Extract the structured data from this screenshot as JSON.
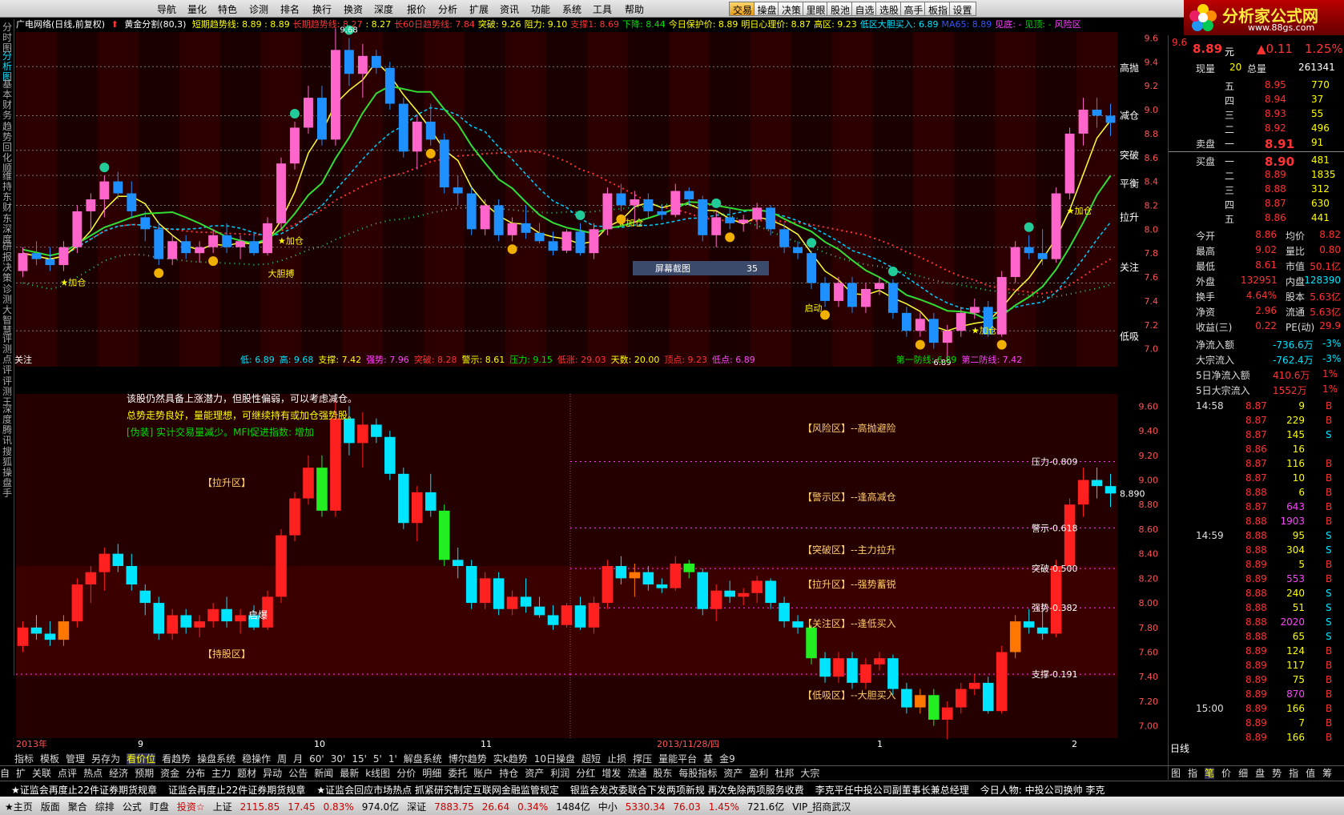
{
  "menu": {
    "items": [
      "导航",
      "量化",
      "特色",
      "诊测",
      "排名",
      "换行",
      "换资",
      "深度",
      "报价",
      "分析",
      "扩展",
      "资讯",
      "功能",
      "系统",
      "工具",
      "帮助"
    ],
    "toolbar": [
      "交易",
      "操盘",
      "决策",
      "里眼",
      "股池",
      "自选",
      "选股",
      "高手",
      "板指",
      "设置"
    ]
  },
  "logo": {
    "title": "分析家公式网",
    "url": "www.88gs.com"
  },
  "sidebar": [
    "分时图",
    "分析图",
    "基本",
    "财务",
    "趋势",
    "回化顺",
    "维持",
    "东财",
    "东深度",
    "研报",
    "决策",
    "诊测",
    "大智慧",
    "评测",
    "点评",
    "评测王",
    "深度",
    "腾讯",
    "搜狐",
    "操盘手"
  ],
  "header": {
    "name": "广电网络(日线,前复权)",
    "indicator": "黄金分割(80,3)",
    "items": [
      {
        "t": "短期趋势线: 8.89 : 8.89",
        "c": "#ffff00"
      },
      {
        "t": "长期趋势线: 8.27",
        "c": "#ff3333"
      },
      {
        "t": ": 8.27",
        "c": "#ffff00"
      },
      {
        "t": "长60日趋势线: 7.84",
        "c": "#ff3333"
      },
      {
        "t": "突破: 9.26",
        "c": "#ffff00"
      },
      {
        "t": "阻力: 9.10",
        "c": "#ffff00"
      },
      {
        "t": "支撑1: 8.69",
        "c": "#ff3333"
      },
      {
        "t": "下降: 8.44",
        "c": "#00e000"
      },
      {
        "t": "今日保护价: 8.89",
        "c": "#ffff00"
      },
      {
        "t": "明日心理价: 8.87",
        "c": "#ffff00"
      },
      {
        "t": "高区: 9.23",
        "c": "#ffff00"
      },
      {
        "t": "低区大胆买入: 6.89",
        "c": "#00e5ff"
      },
      {
        "t": "MA65: 8.89",
        "c": "#3355ff"
      },
      {
        "t": "见底: -",
        "c": "#ff44ff"
      },
      {
        "t": "见顶: -",
        "c": "#00e000"
      },
      {
        "t": "风险区",
        "c": "#ff44ff"
      }
    ]
  },
  "main_chart": {
    "y_ticks": [
      "9.6",
      "9.4",
      "9.2",
      "9.0",
      "8.8",
      "8.6",
      "8.4",
      "8.2",
      "8.0",
      "7.8",
      "7.6",
      "7.4",
      "7.2",
      "7.0"
    ],
    "right_labels": [
      "高抛",
      "减仓",
      "突破",
      "平衡",
      "拉升",
      "关注",
      "低吸"
    ],
    "annotations": [
      "加仓",
      "加仓",
      "加仓",
      "加仓",
      "大胆搏",
      "启动",
      "屏幕截图",
      "35",
      "9.68",
      "6.89"
    ],
    "candles": [
      {
        "o": 7.65,
        "h": 7.85,
        "l": 7.6,
        "c": 7.8
      },
      {
        "o": 7.8,
        "h": 7.9,
        "l": 7.7,
        "c": 7.75
      },
      {
        "o": 7.75,
        "h": 7.85,
        "l": 7.65,
        "c": 7.7
      },
      {
        "o": 7.7,
        "h": 7.9,
        "l": 7.65,
        "c": 7.85
      },
      {
        "o": 7.85,
        "h": 8.2,
        "l": 7.8,
        "c": 8.15
      },
      {
        "o": 8.15,
        "h": 8.3,
        "l": 8.0,
        "c": 8.25
      },
      {
        "o": 8.25,
        "h": 8.45,
        "l": 8.1,
        "c": 8.4
      },
      {
        "o": 8.4,
        "h": 8.48,
        "l": 8.25,
        "c": 8.3
      },
      {
        "o": 8.3,
        "h": 8.4,
        "l": 8.1,
        "c": 8.15
      },
      {
        "o": 8.1,
        "h": 8.15,
        "l": 7.9,
        "c": 8.0
      },
      {
        "o": 8.0,
        "h": 8.05,
        "l": 7.7,
        "c": 7.75
      },
      {
        "o": 7.75,
        "h": 7.95,
        "l": 7.7,
        "c": 7.9
      },
      {
        "o": 7.9,
        "h": 7.95,
        "l": 7.75,
        "c": 7.8
      },
      {
        "o": 7.8,
        "h": 7.9,
        "l": 7.72,
        "c": 7.85
      },
      {
        "o": 7.85,
        "h": 8.0,
        "l": 7.8,
        "c": 7.95
      },
      {
        "o": 7.95,
        "h": 8.05,
        "l": 7.8,
        "c": 7.85
      },
      {
        "o": 7.85,
        "h": 7.95,
        "l": 7.75,
        "c": 7.9
      },
      {
        "o": 7.9,
        "h": 7.98,
        "l": 7.78,
        "c": 7.8
      },
      {
        "o": 7.8,
        "h": 8.1,
        "l": 7.78,
        "c": 8.05
      },
      {
        "o": 8.05,
        "h": 8.6,
        "l": 8.0,
        "c": 8.55
      },
      {
        "o": 8.55,
        "h": 8.9,
        "l": 8.5,
        "c": 8.85
      },
      {
        "o": 8.85,
        "h": 9.2,
        "l": 8.8,
        "c": 9.1
      },
      {
        "o": 9.1,
        "h": 9.2,
        "l": 8.7,
        "c": 8.75
      },
      {
        "o": 8.75,
        "h": 9.68,
        "l": 8.7,
        "c": 9.5
      },
      {
        "o": 9.5,
        "h": 9.6,
        "l": 9.2,
        "c": 9.3
      },
      {
        "o": 9.3,
        "h": 9.55,
        "l": 9.1,
        "c": 9.45
      },
      {
        "o": 9.45,
        "h": 9.5,
        "l": 9.3,
        "c": 9.35
      },
      {
        "o": 9.35,
        "h": 9.4,
        "l": 9.0,
        "c": 9.05
      },
      {
        "o": 9.05,
        "h": 9.1,
        "l": 8.6,
        "c": 8.65
      },
      {
        "o": 8.65,
        "h": 8.95,
        "l": 8.5,
        "c": 8.9
      },
      {
        "o": 8.9,
        "h": 9.05,
        "l": 8.7,
        "c": 8.75
      },
      {
        "o": 8.75,
        "h": 8.8,
        "l": 8.3,
        "c": 8.35
      },
      {
        "o": 8.35,
        "h": 8.45,
        "l": 8.2,
        "c": 8.3
      },
      {
        "o": 8.3,
        "h": 8.35,
        "l": 7.95,
        "c": 8.0
      },
      {
        "o": 8.0,
        "h": 8.25,
        "l": 7.95,
        "c": 8.2
      },
      {
        "o": 8.2,
        "h": 8.25,
        "l": 7.9,
        "c": 7.95
      },
      {
        "o": 7.95,
        "h": 8.1,
        "l": 7.9,
        "c": 8.05
      },
      {
        "o": 8.05,
        "h": 8.2,
        "l": 7.92,
        "c": 7.97
      },
      {
        "o": 7.97,
        "h": 8.05,
        "l": 7.88,
        "c": 7.9
      },
      {
        "o": 7.9,
        "h": 7.98,
        "l": 7.78,
        "c": 7.82
      },
      {
        "o": 7.82,
        "h": 8.0,
        "l": 7.8,
        "c": 7.98
      },
      {
        "o": 7.98,
        "h": 8.05,
        "l": 7.78,
        "c": 7.8
      },
      {
        "o": 7.8,
        "h": 8.05,
        "l": 7.75,
        "c": 8.0
      },
      {
        "o": 8.0,
        "h": 8.35,
        "l": 7.95,
        "c": 8.3
      },
      {
        "o": 8.3,
        "h": 8.38,
        "l": 8.15,
        "c": 8.2
      },
      {
        "o": 8.2,
        "h": 8.32,
        "l": 8.05,
        "c": 8.25
      },
      {
        "o": 8.25,
        "h": 8.3,
        "l": 8.1,
        "c": 8.15
      },
      {
        "o": 8.15,
        "h": 8.2,
        "l": 8.08,
        "c": 8.12
      },
      {
        "o": 8.12,
        "h": 8.38,
        "l": 8.1,
        "c": 8.32
      },
      {
        "o": 8.32,
        "h": 8.35,
        "l": 8.2,
        "c": 8.25
      },
      {
        "o": 8.25,
        "h": 8.28,
        "l": 7.9,
        "c": 7.95
      },
      {
        "o": 7.95,
        "h": 8.15,
        "l": 7.85,
        "c": 8.1
      },
      {
        "o": 8.1,
        "h": 8.18,
        "l": 8.0,
        "c": 8.05
      },
      {
        "o": 8.05,
        "h": 8.12,
        "l": 7.98,
        "c": 8.08
      },
      {
        "o": 8.08,
        "h": 8.22,
        "l": 8.0,
        "c": 8.18
      },
      {
        "o": 8.18,
        "h": 8.2,
        "l": 7.95,
        "c": 8.0
      },
      {
        "o": 8.0,
        "h": 8.05,
        "l": 7.8,
        "c": 7.85
      },
      {
        "o": 7.85,
        "h": 7.9,
        "l": 7.75,
        "c": 7.8
      },
      {
        "o": 7.8,
        "h": 7.82,
        "l": 7.5,
        "c": 7.55
      },
      {
        "o": 7.55,
        "h": 7.6,
        "l": 7.35,
        "c": 7.4
      },
      {
        "o": 7.4,
        "h": 7.6,
        "l": 7.35,
        "c": 7.55
      },
      {
        "o": 7.55,
        "h": 7.6,
        "l": 7.3,
        "c": 7.35
      },
      {
        "o": 7.35,
        "h": 7.55,
        "l": 7.3,
        "c": 7.5
      },
      {
        "o": 7.5,
        "h": 7.6,
        "l": 7.45,
        "c": 7.55
      },
      {
        "o": 7.55,
        "h": 7.58,
        "l": 7.25,
        "c": 7.3
      },
      {
        "o": 7.3,
        "h": 7.35,
        "l": 7.1,
        "c": 7.15
      },
      {
        "o": 7.15,
        "h": 7.3,
        "l": 7.1,
        "c": 7.25
      },
      {
        "o": 7.25,
        "h": 7.3,
        "l": 7.0,
        "c": 7.05
      },
      {
        "o": 7.05,
        "h": 7.2,
        "l": 6.89,
        "c": 7.15
      },
      {
        "o": 7.15,
        "h": 7.35,
        "l": 7.1,
        "c": 7.3
      },
      {
        "o": 7.3,
        "h": 7.42,
        "l": 7.25,
        "c": 7.35
      },
      {
        "o": 7.35,
        "h": 7.4,
        "l": 7.1,
        "c": 7.12
      },
      {
        "o": 7.12,
        "h": 7.65,
        "l": 7.1,
        "c": 7.6
      },
      {
        "o": 7.6,
        "h": 7.9,
        "l": 7.55,
        "c": 7.85
      },
      {
        "o": 7.85,
        "h": 7.95,
        "l": 7.75,
        "c": 7.8
      },
      {
        "o": 7.8,
        "h": 8.0,
        "l": 7.7,
        "c": 7.75
      },
      {
        "o": 7.75,
        "h": 8.35,
        "l": 7.72,
        "c": 8.3
      },
      {
        "o": 8.3,
        "h": 8.85,
        "l": 8.25,
        "c": 8.8
      },
      {
        "o": 8.8,
        "h": 9.1,
        "l": 8.7,
        "c": 9.0
      },
      {
        "o": 9.0,
        "h": 9.1,
        "l": 8.85,
        "c": 8.95
      },
      {
        "o": 8.95,
        "h": 9.05,
        "l": 8.78,
        "c": 8.89
      }
    ]
  },
  "main_stats": {
    "left": "关注",
    "items": [
      {
        "t": "低: 6.89",
        "c": "#00e5ff"
      },
      {
        "t": "高: 9.68",
        "c": "#00e5ff"
      },
      {
        "t": "支撑: 7.42",
        "c": "#ffff00"
      },
      {
        "t": "强势: 7.96",
        "c": "#ff44ff"
      },
      {
        "t": "突破: 8.28",
        "c": "#ff3333"
      },
      {
        "t": "警示: 8.61",
        "c": "#ffff00"
      },
      {
        "t": "压力: 9.15",
        "c": "#00e000"
      },
      {
        "t": "低涨: 29.03",
        "c": "#ff3333"
      },
      {
        "t": "天数: 20.00",
        "c": "#ffff00"
      },
      {
        "t": "顶点: 9.23",
        "c": "#ff3333"
      },
      {
        "t": "低点: 6.89",
        "c": "#ff44ff"
      }
    ],
    "right": [
      {
        "t": "第一防线: 6.89",
        "c": "#00e000"
      },
      {
        "t": "第二防线: 7.42",
        "c": "#ff44ff"
      }
    ]
  },
  "lower_chart": {
    "texts": [
      {
        "t": "该股仍然具备上涨潜力，但股性偏弱，可以考虑减仓。",
        "c": "#fff"
      },
      {
        "t": "总势走势良好，量能理想，可继续持有或加仓强势股。",
        "c": "#ffff00"
      },
      {
        "t": "[伪装] 实计交易量减少。MFI促进指数: 增加",
        "c": "#00e000"
      }
    ],
    "zones_left": [
      "【拉升区】",
      "【持股区】"
    ],
    "zones_right": [
      "【风险区】--高抛避险",
      "【警示区】--逢高减仓",
      "【突破区】--主力拉升",
      "【拉升区】--强势蓄锐",
      "【关注区】--逢低买入",
      "【低吸区】--大胆买入"
    ],
    "levels": [
      "压力-0.809",
      "警示-0.618",
      "突破-0.500",
      "强势-0.382",
      "支撑-0.191"
    ],
    "y_ticks": [
      "9.60",
      "9.40",
      "9.20",
      "9.00",
      "8.80",
      "8.60",
      "8.40",
      "8.20",
      "8.00",
      "7.80",
      "7.60",
      "7.40",
      "7.20",
      "7.00"
    ],
    "last": "8.890",
    "start_label": "启爆",
    "x_labels": [
      "2013年",
      "9",
      "10",
      "11",
      "2013/11/28/四",
      "1",
      "2"
    ]
  },
  "quote": {
    "price": "8.89",
    "unit": "元",
    "change": "▲0.11",
    "pct": "1.25%",
    "xianliang_label": "现量",
    "xianliang": "20",
    "zongliang_label": "总量",
    "zongliang": "261341",
    "sell": [
      {
        "n": "五",
        "p": "8.95",
        "v": "770"
      },
      {
        "n": "四",
        "p": "8.94",
        "v": "37"
      },
      {
        "n": "三",
        "p": "8.93",
        "v": "55"
      },
      {
        "n": "二",
        "p": "8.92",
        "v": "496"
      },
      {
        "n": "一",
        "p": "8.91",
        "v": "91"
      }
    ],
    "buy": [
      {
        "n": "一",
        "p": "8.90",
        "v": "481"
      },
      {
        "n": "二",
        "p": "8.89",
        "v": "1835"
      },
      {
        "n": "三",
        "p": "8.88",
        "v": "312"
      },
      {
        "n": "四",
        "p": "8.87",
        "v": "630"
      },
      {
        "n": "五",
        "p": "8.86",
        "v": "441"
      }
    ],
    "sell_label": "卖盘",
    "buy_label": "买盘",
    "stats": [
      {
        "a": "今开",
        "b": "8.86",
        "c": "均价",
        "d": "8.82"
      },
      {
        "a": "最高",
        "b": "9.02",
        "c": "量比",
        "d": "0.80"
      },
      {
        "a": "最低",
        "b": "8.61",
        "c": "市值",
        "d": "50.1亿"
      },
      {
        "a": "外盘",
        "b": "132951",
        "c": "内盘",
        "d": "128390"
      },
      {
        "a": "换手",
        "b": "4.64%",
        "c": "股本",
        "d": "5.63亿"
      },
      {
        "a": "净资",
        "b": "2.96",
        "c": "流通",
        "d": "5.63亿"
      },
      {
        "a": "收益(三)",
        "b": "0.22",
        "c": "PE(动)",
        "d": "29.9"
      }
    ],
    "flows": [
      {
        "a": "净流入额",
        "b": "-736.6万",
        "c": "-3%"
      },
      {
        "a": "大宗流入",
        "b": "-762.4万",
        "c": "-3%"
      },
      {
        "a": "5日净流入额",
        "b": "410.6万",
        "c": "1%"
      },
      {
        "a": "5日大宗流入",
        "b": "1552万",
        "c": "1%"
      }
    ],
    "ticks": [
      {
        "t": "14:58",
        "p": "8.87",
        "v": "9",
        "s": "B"
      },
      {
        "t": "",
        "p": "8.87",
        "v": "229",
        "s": "B"
      },
      {
        "t": "",
        "p": "8.87",
        "v": "145",
        "s": "S"
      },
      {
        "t": "",
        "p": "8.86",
        "v": "16",
        "s": ""
      },
      {
        "t": "",
        "p": "8.87",
        "v": "116",
        "s": "B"
      },
      {
        "t": "",
        "p": "8.87",
        "v": "10",
        "s": "B"
      },
      {
        "t": "",
        "p": "8.88",
        "v": "6",
        "s": "B"
      },
      {
        "t": "",
        "p": "8.87",
        "v": "643",
        "s": "B"
      },
      {
        "t": "",
        "p": "8.88",
        "v": "1903",
        "s": "B"
      },
      {
        "t": "14:59",
        "p": "8.88",
        "v": "95",
        "s": "S"
      },
      {
        "t": "",
        "p": "8.88",
        "v": "304",
        "s": "S"
      },
      {
        "t": "",
        "p": "8.89",
        "v": "5",
        "s": "B"
      },
      {
        "t": "",
        "p": "8.89",
        "v": "553",
        "s": "B"
      },
      {
        "t": "",
        "p": "8.88",
        "v": "240",
        "s": "S"
      },
      {
        "t": "",
        "p": "8.88",
        "v": "51",
        "s": "S"
      },
      {
        "t": "",
        "p": "8.88",
        "v": "2020",
        "s": "S"
      },
      {
        "t": "",
        "p": "8.88",
        "v": "65",
        "s": "S"
      },
      {
        "t": "",
        "p": "8.89",
        "v": "124",
        "s": "B"
      },
      {
        "t": "",
        "p": "8.89",
        "v": "117",
        "s": "B"
      },
      {
        "t": "",
        "p": "8.89",
        "v": "75",
        "s": "B"
      },
      {
        "t": "",
        "p": "8.89",
        "v": "870",
        "s": "B"
      },
      {
        "t": "15:00",
        "p": "8.89",
        "v": "166",
        "s": "B"
      },
      {
        "t": "",
        "p": "8.89",
        "v": "7",
        "s": "B"
      },
      {
        "t": "",
        "p": "8.89",
        "v": "166",
        "s": "B"
      }
    ],
    "rtabs_label": "日线",
    "rtabs": [
      "图",
      "指",
      "笔",
      "价",
      "细",
      "盘",
      "势",
      "指",
      "值",
      "筹"
    ]
  },
  "tabs1": [
    "指标",
    "模板",
    "管理",
    "另存为",
    "看价位",
    "看趋势",
    "操盘系统",
    "稳操作",
    "周",
    "月",
    "60'",
    "30'",
    "15'",
    "5'",
    "1'",
    "解盘系统",
    "博尔趋势",
    "实k趋势",
    "10日操盘",
    "超短",
    "止损",
    "撑压",
    "量能平台",
    "基",
    "金9"
  ],
  "tabs2": [
    "自",
    "扩",
    "关联",
    "点评",
    "热点",
    "经济",
    "预期",
    "资金",
    "分布",
    "主力",
    "题材",
    "异动",
    "公告",
    "新闻",
    "最新",
    "k线图",
    "分价",
    "明细",
    "委托",
    "账户",
    "持仓",
    "资产",
    "利润",
    "分红",
    "增发",
    "流通",
    "股东",
    "每股指标",
    "资产",
    "盈利",
    "杜邦",
    "大宗"
  ],
  "news": [
    "★证监会再度止22件证券期货规章",
    "证监会再度止22件证券期货规章",
    "★证监会回应市场热点 抓紧研究制定互联网金融监管规定",
    "银监会发改委联合下发两项新规 再次免除两项服务收费",
    "李克平任中投公司副董事长兼总经理",
    "今日人物: 中投公司换帅 李克"
  ],
  "status": {
    "items": [
      {
        "t": "★主页",
        "c": "#000"
      },
      {
        "t": "版面",
        "c": "#000"
      },
      {
        "t": "聚合",
        "c": "#000"
      },
      {
        "t": "综排",
        "c": "#000"
      },
      {
        "t": "公式",
        "c": "#000"
      },
      {
        "t": "盯盘",
        "c": "#000"
      },
      {
        "t": "投资☆",
        "c": "#c00"
      },
      {
        "t": "上证",
        "c": "#000"
      },
      {
        "t": "2115.85",
        "c": "#c00"
      },
      {
        "t": "17.45",
        "c": "#c00"
      },
      {
        "t": "0.83%",
        "c": "#c00"
      },
      {
        "t": "974.0亿",
        "c": "#000"
      },
      {
        "t": "深证",
        "c": "#000"
      },
      {
        "t": "7883.75",
        "c": "#c00"
      },
      {
        "t": "26.64",
        "c": "#c00"
      },
      {
        "t": "0.34%",
        "c": "#c00"
      },
      {
        "t": "1484亿",
        "c": "#000"
      },
      {
        "t": "中小",
        "c": "#000"
      },
      {
        "t": "5330.34",
        "c": "#c00"
      },
      {
        "t": "76.03",
        "c": "#c00"
      },
      {
        "t": "1.45%",
        "c": "#c00"
      },
      {
        "t": "721.6亿",
        "c": "#000"
      },
      {
        "t": "VIP_招商武汉",
        "c": "#000"
      }
    ]
  },
  "colors": {
    "up": "#ff66cc",
    "down": "#1e90ff",
    "up2": "#ff2020",
    "down2": "#00e5ff",
    "bg_lower": "#2a0000"
  }
}
